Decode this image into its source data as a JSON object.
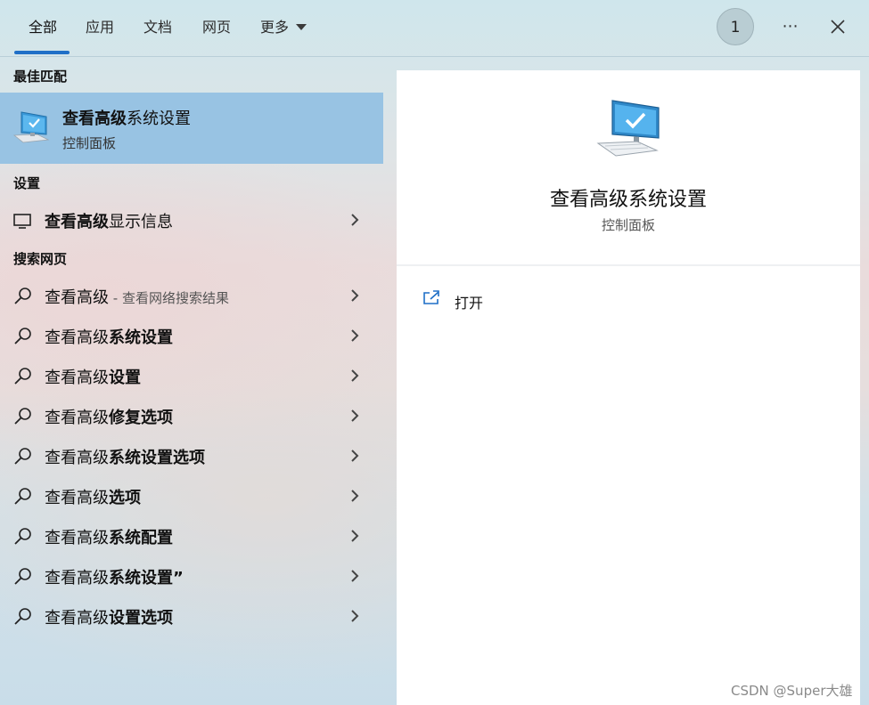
{
  "tabs": [
    {
      "label": "全部",
      "active": true
    },
    {
      "label": "应用"
    },
    {
      "label": "文档"
    },
    {
      "label": "网页"
    },
    {
      "label": "更多"
    }
  ],
  "header": {
    "avatar_text": "1",
    "more_icon": "ellipsis-icon",
    "close_icon": "close-icon"
  },
  "sections": {
    "best_match": "最佳匹配",
    "settings": "设置",
    "web_search": "搜索网页"
  },
  "best_match": {
    "title_bold": "查看高级",
    "title_rest": "系统设置",
    "subtitle": "控制面板",
    "icon": "computer-monitor-icon"
  },
  "settings_items": [
    {
      "bold": "查看高级",
      "rest": "显示信息",
      "icon": "display-icon"
    }
  ],
  "web_items": [
    {
      "plain": "查看高级",
      "hint": " - 查看网络搜索结果",
      "bold": ""
    },
    {
      "plain": "查看高级",
      "bold": "系统设置"
    },
    {
      "plain": "查看高级",
      "bold": "设置"
    },
    {
      "plain": "查看高级",
      "bold": "修复选项"
    },
    {
      "plain": "查看高级",
      "bold": "系统设置选项"
    },
    {
      "plain": "查看高级",
      "bold": "选项"
    },
    {
      "plain": "查看高级",
      "bold": "系统配置"
    },
    {
      "plain": "查看高级",
      "bold": "系统设置”"
    },
    {
      "plain": "查看高级",
      "bold": "设置选项"
    }
  ],
  "preview": {
    "title": "查看高级系统设置",
    "subtitle": "控制面板",
    "action_label": "打开",
    "action_icon": "open-external-icon"
  },
  "watermark": "CSDN @Super大雄",
  "colors": {
    "accent": "#1f6fc7",
    "selected_bg": "#98c3e3"
  }
}
